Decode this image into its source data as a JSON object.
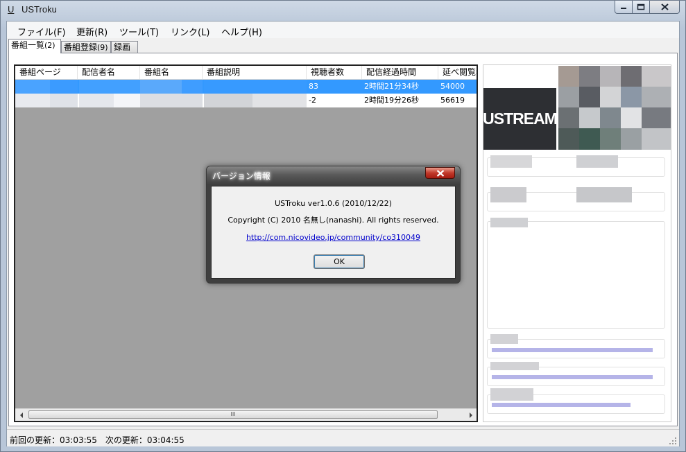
{
  "window": {
    "icon_letter": "U",
    "title": "USTroku"
  },
  "menu": [
    "ファイル(F)",
    "更新(R)",
    "ツール(T)",
    "リンク(L)",
    "ヘルプ(H)"
  ],
  "tabs": [
    {
      "label": "番組一覧",
      "count": "(2)",
      "active": true
    },
    {
      "label": "番組登録",
      "count": "(9)",
      "active": false
    },
    {
      "label": "録画",
      "count": "",
      "active": false
    }
  ],
  "list": {
    "columns": [
      "番組ページ",
      "配信者名",
      "番組名",
      "番組説明",
      "視聴者数",
      "配信経過時間",
      "延べ閲覧者"
    ],
    "rows": [
      {
        "viewers": "83",
        "elapsed": "2時間21分34秒",
        "total": "54000",
        "selected": true
      },
      {
        "viewers": "-2",
        "elapsed": "2時間19分26秒",
        "total": "56619",
        "selected": false
      }
    ],
    "scrollbar_grip": "III"
  },
  "side": {
    "logo_text": "USTREAM"
  },
  "status": {
    "text": "前回の更新：03:03:55　次の更新：03:04:55"
  },
  "dialog": {
    "title": "バージョン情報",
    "version_line": "USTroku ver1.0.6 (2010/12/22)",
    "copyright_line": "Copyright (C) 2010 名無し(nanashi). All rights reserved.",
    "link": "http://com.nicovideo.jp/community/co310049",
    "ok_label": "OK"
  },
  "colors": {
    "selection": "#3399ff",
    "link": "#0000cc",
    "close_button": "#c2392a"
  }
}
